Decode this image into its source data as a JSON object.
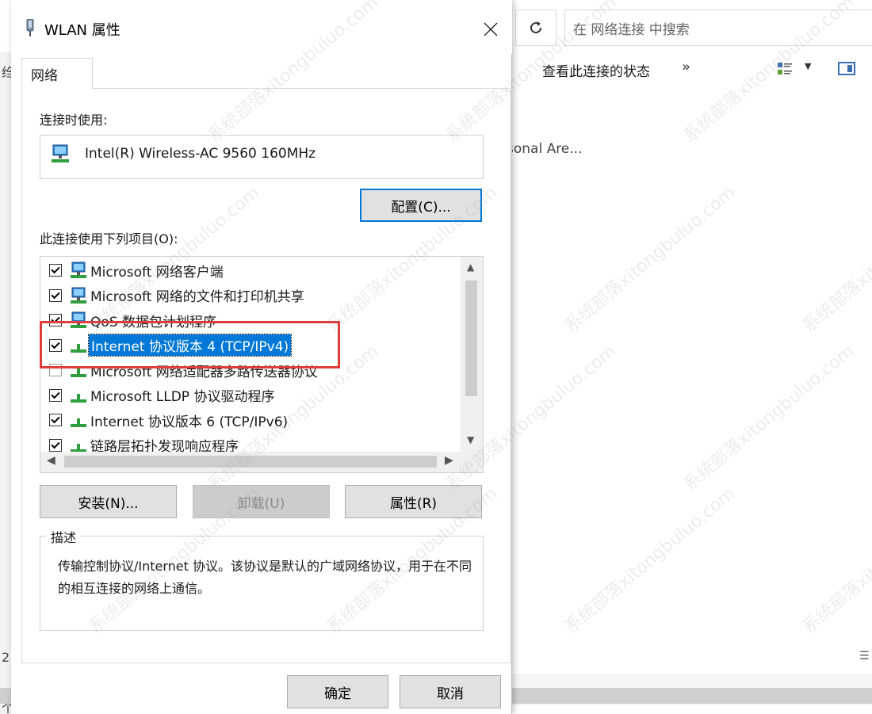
{
  "explorer": {
    "search_placeholder": "在 网络连接 中搜索",
    "view_status_label": "查看此连接的状态",
    "more_label": "»",
    "personal_area_text": "rsonal Are...",
    "left_glyph_1": "绉",
    "left_glyph_2": "2",
    "left_glyph_3": "个"
  },
  "dialog": {
    "title": "WLAN 属性",
    "tab_label": "网络",
    "connect_using_label": "连接时使用:",
    "adapter_name": "Intel(R) Wireless-AC 9560 160MHz",
    "configure_button": "配置(C)...",
    "items_label": "此连接使用下列项目(O):",
    "items": [
      {
        "label": "Microsoft 网络客户端",
        "checked": true,
        "icon": "network-client-icon"
      },
      {
        "label": "Microsoft 网络的文件和打印机共享",
        "checked": true,
        "icon": "network-client-icon"
      },
      {
        "label": "QoS 数据包计划程序",
        "checked": true,
        "icon": "network-client-icon"
      },
      {
        "label": "Internet 协议版本 4 (TCP/IPv4)",
        "checked": true,
        "icon": "protocol-icon",
        "selected": true
      },
      {
        "label": "Microsoft 网络适配器多路传送器协议",
        "checked": false,
        "icon": "protocol-icon"
      },
      {
        "label": "Microsoft LLDP 协议驱动程序",
        "checked": true,
        "icon": "protocol-icon"
      },
      {
        "label": "Internet 协议版本 6 (TCP/IPv6)",
        "checked": true,
        "icon": "protocol-icon"
      },
      {
        "label": "链路层拓扑发现响应程序",
        "checked": true,
        "icon": "protocol-icon"
      }
    ],
    "install_button": "安装(N)...",
    "uninstall_button": "卸载(U)",
    "properties_button": "属性(R)",
    "description_title": "描述",
    "description_text": "传输控制协议/Internet 协议。该协议是默认的广域网络协议，用于在不同的相互连接的网络上通信。",
    "ok_button": "确定",
    "cancel_button": "取消"
  },
  "watermark_text": "系统部落xitongbuluo.com",
  "colors": {
    "accent": "#0078d7",
    "highlight_box": "#e03c3c",
    "button_face": "#e1e1e1"
  }
}
